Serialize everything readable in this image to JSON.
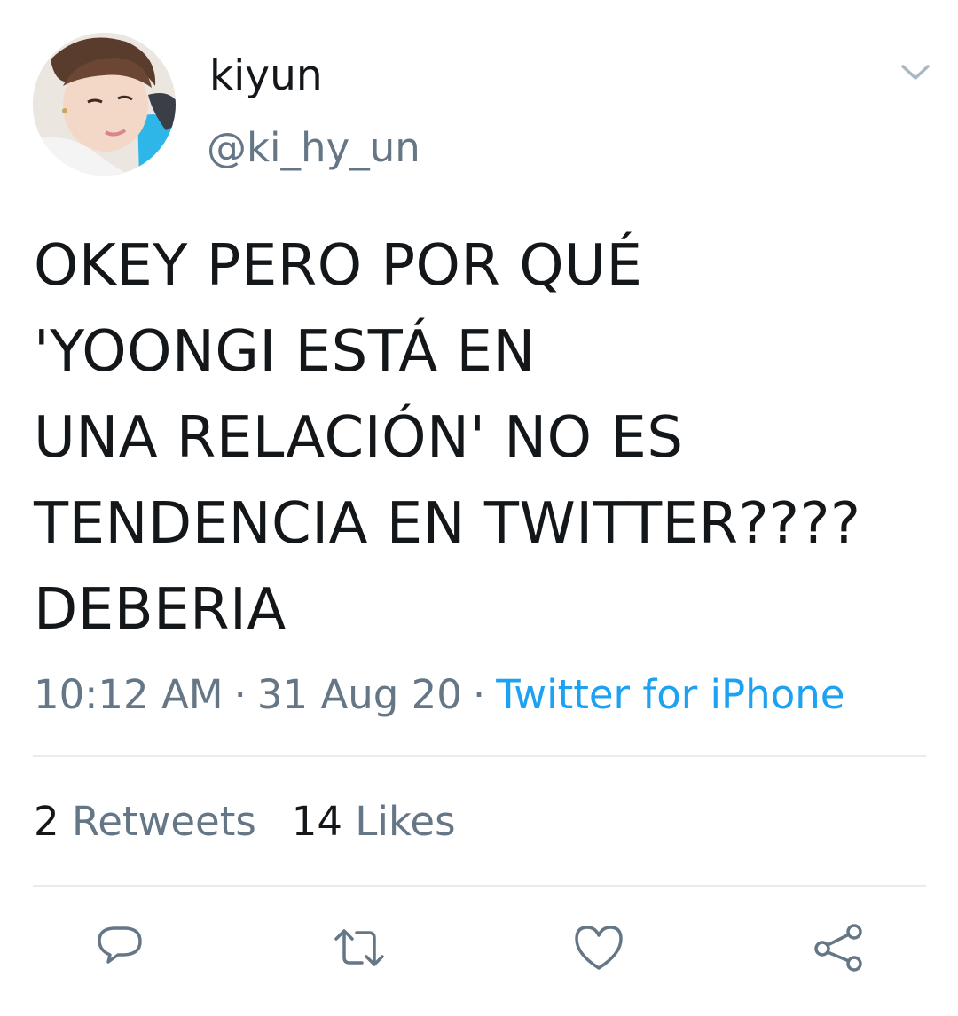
{
  "tweet": {
    "author": {
      "display_name": "kiyun",
      "handle": "@ki_hy_un"
    },
    "text": "OKEY PERO POR QUÉ\n'YOONGI ESTÁ EN\nUNA RELACIÓN' NO ES\nTENDENCIA EN TWITTER????\nDEBERIA",
    "time": "10:12 AM",
    "date": "31 Aug 20",
    "separator": "·",
    "source": "Twitter for iPhone",
    "stats": {
      "retweets_count": "2",
      "retweets_label": "Retweets",
      "likes_count": "14",
      "likes_label": "Likes"
    }
  },
  "icons": {
    "menu": "chevron-down-icon",
    "actions": [
      "reply-icon",
      "retweet-icon",
      "like-icon",
      "share-icon"
    ]
  },
  "colors": {
    "text_primary": "#14171a",
    "text_secondary": "#657786",
    "link": "#1da1f2",
    "divider": "#e6ecf0"
  }
}
